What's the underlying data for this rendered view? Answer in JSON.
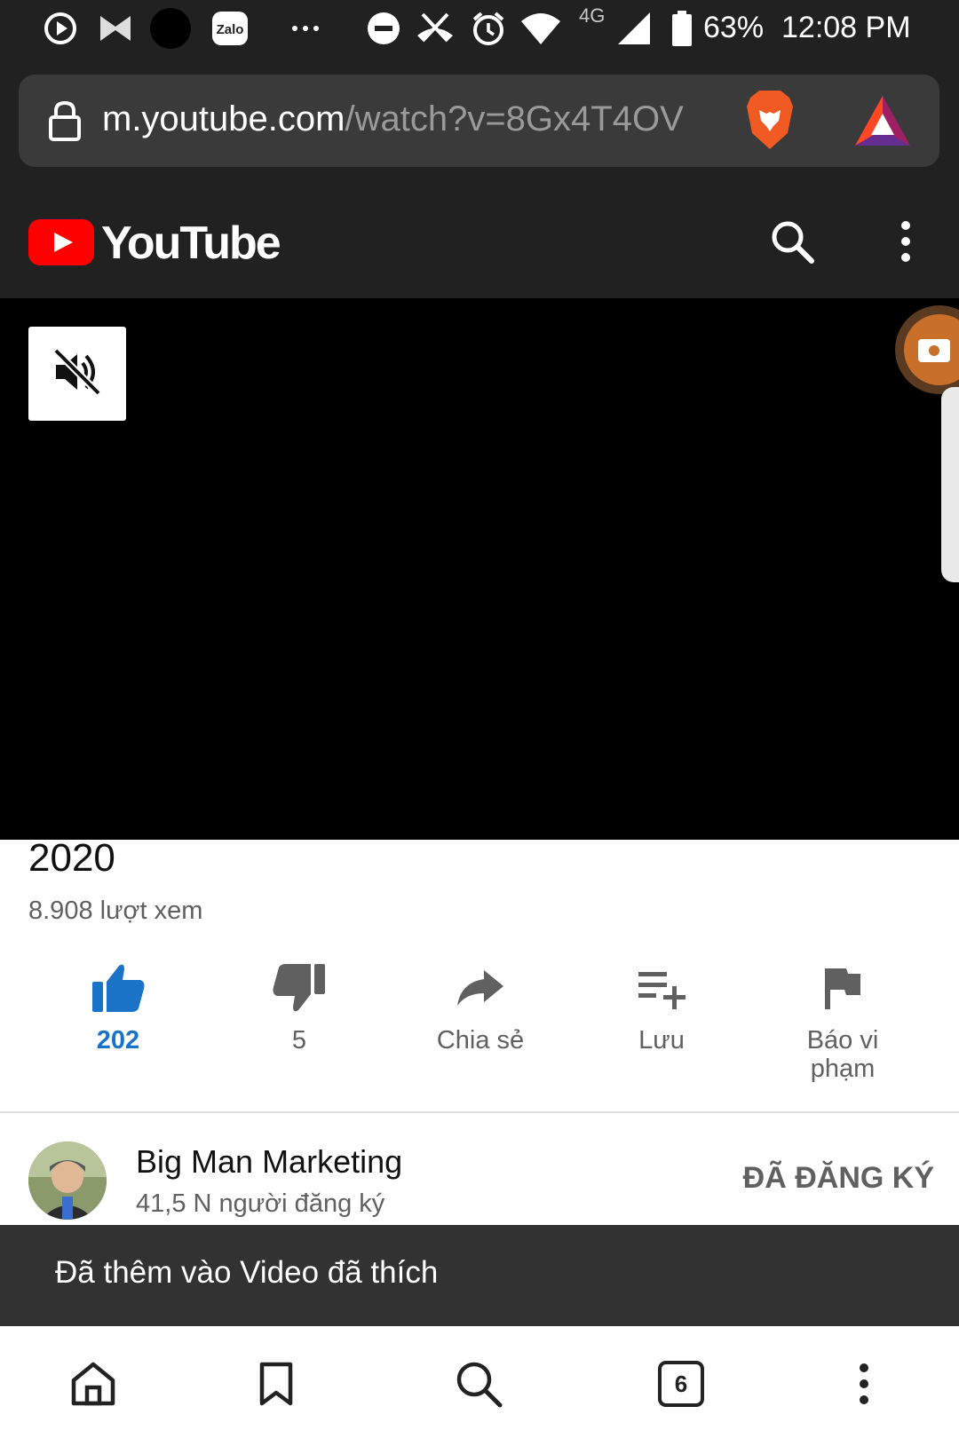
{
  "status_bar": {
    "battery": "63%",
    "time": "12:08 PM",
    "network": "4G",
    "icons": [
      "play-icon",
      "bowtie-app-icon",
      "black-circle-icon",
      "zalo-icon",
      "more-notifications-icon",
      "do-not-disturb-icon",
      "missed-call-icon",
      "alarm-icon",
      "wifi-icon",
      "signal-icon",
      "battery-icon"
    ],
    "zalo_label": "Zalo"
  },
  "browser": {
    "url_host": "m.youtube.com",
    "url_path": "/watch?v=8Gx4T4OV",
    "icons": [
      "lock-icon",
      "brave-shields-icon",
      "bat-rewards-icon"
    ]
  },
  "youtube_header": {
    "wordmark": "YouTube",
    "icons": [
      "youtube-logo-icon",
      "search-icon",
      "more-vert-icon"
    ]
  },
  "video": {
    "mute_icon": "volume-off-icon"
  },
  "video_info": {
    "title_fragment": "2020",
    "views": "8.908 lượt xem"
  },
  "actions": {
    "like_count": "202",
    "dislike_count": "5",
    "share_label": "Chia sẻ",
    "save_label": "Lưu",
    "report_label_line1": "Báo vi",
    "report_label_line2": "phạm"
  },
  "channel": {
    "name": "Big Man Marketing",
    "subscribers": "41,5 N người đăng ký",
    "subscribe_state": "ĐÃ ĐĂNG KÝ"
  },
  "snackbar": {
    "message": "Đã thêm vào Video đã thích"
  },
  "bottom_nav": {
    "tab_count": "6",
    "icons": [
      "home-icon",
      "bookmark-icon",
      "search-icon",
      "tabs-icon",
      "more-vert-icon"
    ]
  },
  "colors": {
    "chrome_dark": "#212121",
    "like_blue": "#1a73c6",
    "youtube_red": "#ff0000",
    "snackbar": "#323232"
  }
}
